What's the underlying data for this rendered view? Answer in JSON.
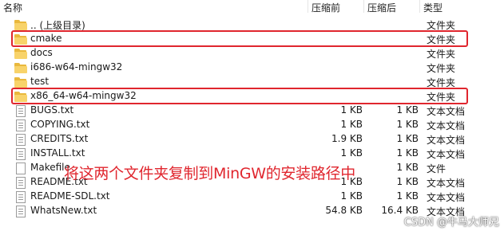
{
  "header": {
    "name": "名称",
    "compressed": "压缩前",
    "original": "压缩后",
    "type": "类型"
  },
  "rows": [
    {
      "kind": "folder",
      "name": ".. (上级目录)",
      "compressed": "",
      "original": "",
      "type": "文件夹"
    },
    {
      "kind": "folder",
      "name": "cmake",
      "compressed": "",
      "original": "",
      "type": "文件夹"
    },
    {
      "kind": "folder",
      "name": "docs",
      "compressed": "",
      "original": "",
      "type": "文件夹"
    },
    {
      "kind": "folder",
      "name": "i686-w64-mingw32",
      "compressed": "",
      "original": "",
      "type": "文件夹"
    },
    {
      "kind": "folder",
      "name": "test",
      "compressed": "",
      "original": "",
      "type": "文件夹"
    },
    {
      "kind": "folder",
      "name": "x86_64-w64-mingw32",
      "compressed": "",
      "original": "",
      "type": "文件夹"
    },
    {
      "kind": "file",
      "name": "BUGS.txt",
      "compressed": "1 KB",
      "original": "1 KB",
      "type": "文本文档"
    },
    {
      "kind": "file",
      "name": "COPYING.txt",
      "compressed": "1 KB",
      "original": "1 KB",
      "type": "文本文档"
    },
    {
      "kind": "file",
      "name": "CREDITS.txt",
      "compressed": "1.9 KB",
      "original": "1 KB",
      "type": "文本文档"
    },
    {
      "kind": "file",
      "name": "INSTALL.txt",
      "compressed": "1 KB",
      "original": "1 KB",
      "type": "文本文档"
    },
    {
      "kind": "file",
      "name": "Makefile",
      "compressed": "",
      "original": "1 KB",
      "type": "文件"
    },
    {
      "kind": "file",
      "name": "README.txt",
      "compressed": "1 KB",
      "original": "1 KB",
      "type": "文本文档"
    },
    {
      "kind": "file",
      "name": "README-SDL.txt",
      "compressed": "1 KB",
      "original": "1 KB",
      "type": "文本文档"
    },
    {
      "kind": "file",
      "name": "WhatsNew.txt",
      "compressed": "54.8 KB",
      "original": "16.4 KB",
      "type": "文本文档"
    }
  ],
  "annotation": "将这两个文件夹复制到MinGW的安装路径中",
  "watermark": "CSDN @牛马大师兄",
  "colors": {
    "highlight": "#e0262e",
    "folder": "#f8d36a"
  }
}
